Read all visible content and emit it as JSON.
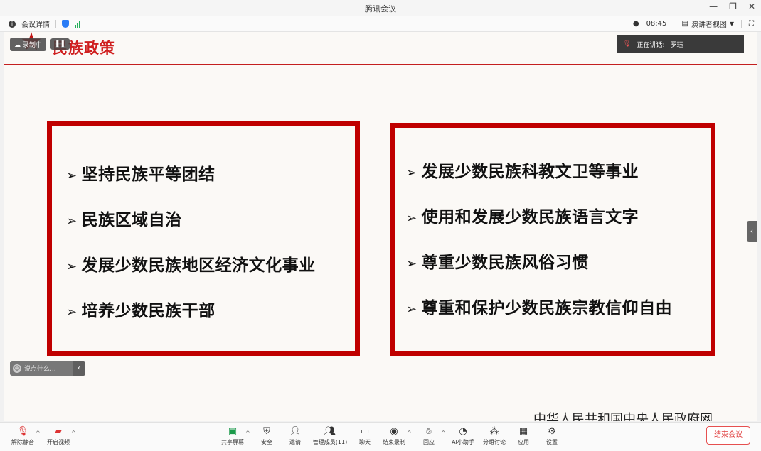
{
  "window": {
    "title": "腾讯会议",
    "minimize_icon": "minimize-icon",
    "restore_icon": "restore-icon",
    "close_icon": "close-icon"
  },
  "infobar": {
    "meeting_details": "会议详情",
    "time": "08:45",
    "view_label": "演讲者视图"
  },
  "stage_overlay": {
    "recording_label": "录制中",
    "speaking_label": "正在讲话:",
    "speaker_name": "罗珏"
  },
  "slide": {
    "title": "民族政策",
    "left_items": [
      "坚持民族平等团结",
      "民族区域自治",
      "发展少数民族地区经济文化事业",
      "培养少数民族干部"
    ],
    "right_items": [
      "发展少数民族科教文卫等事业",
      "使用和发展少数民族语言文字",
      "尊重少数民族风俗习惯",
      "尊重和保护少数民族宗教信仰自由"
    ],
    "footer_partial": "中华人民共和国中央人民政府网"
  },
  "chat": {
    "placeholder": "说点什么..."
  },
  "toolbar": {
    "unmute": "解除静音",
    "start_video": "开启视频",
    "share_screen": "共享屏幕",
    "security": "安全",
    "invite": "邀请",
    "manage_members": "管理成员(11)",
    "chat": "聊天",
    "end_recording": "结束录制",
    "reactions": "回应",
    "ai_assistant": "AI小助手",
    "breakout": "分组讨论",
    "apps": "应用",
    "settings": "设置",
    "end_meeting": "结束会议"
  },
  "colors": {
    "accent_red": "#c00000",
    "brand_blue": "#2a7cf6",
    "signal_green": "#25b05a"
  }
}
